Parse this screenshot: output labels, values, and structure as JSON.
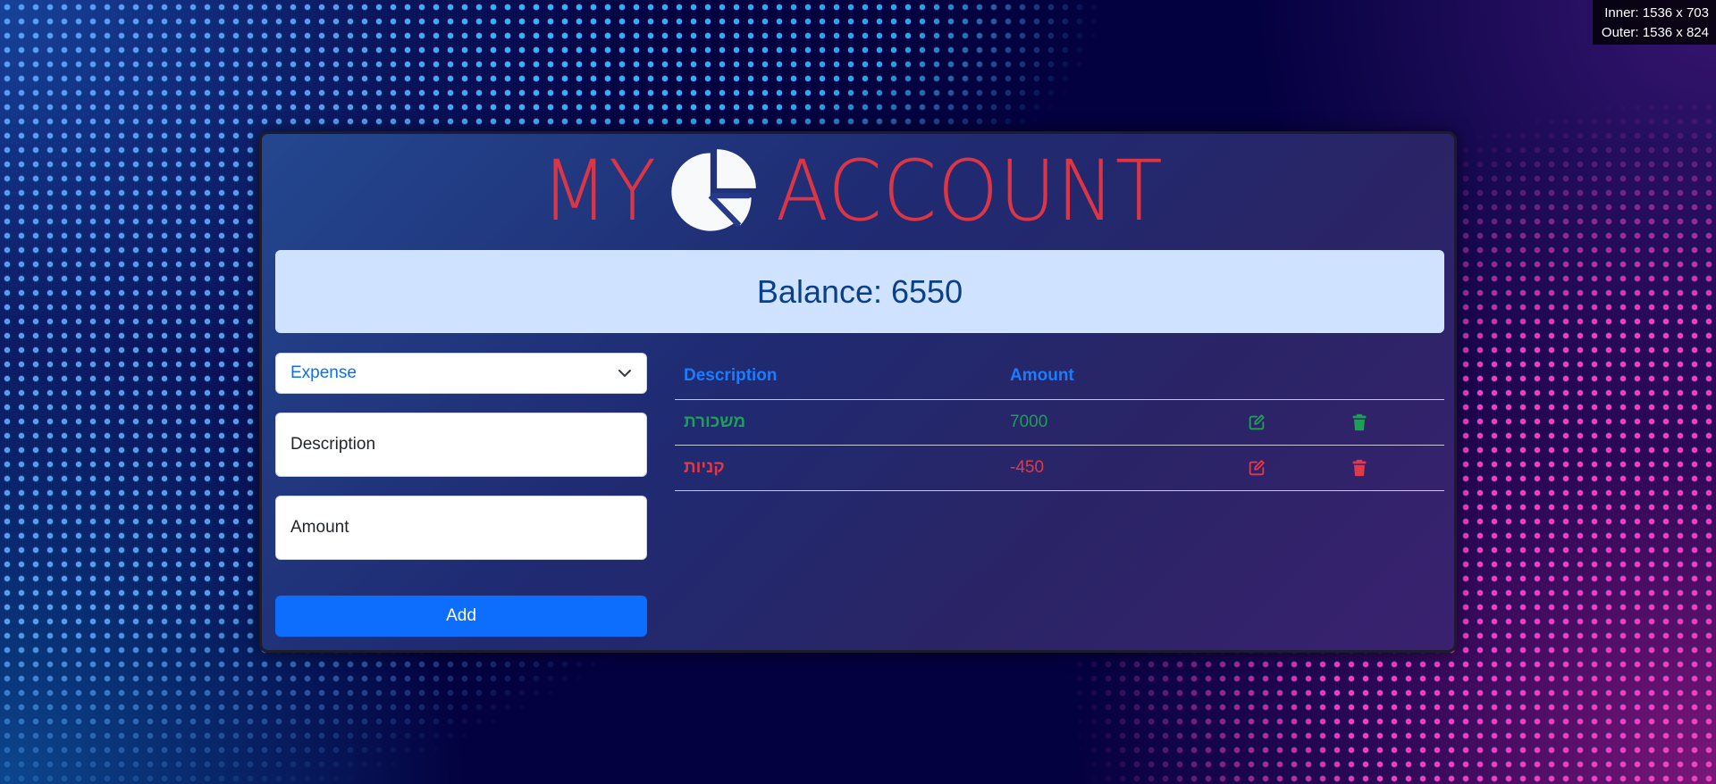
{
  "window_size_overlay": {
    "inner": "Inner: 1536 x 703",
    "outer": "Outer: 1536 x 824"
  },
  "logo": {
    "left_text": "MY",
    "right_text": "ACCOUNT",
    "icon": "pie-chart-icon",
    "color": "#dc3545"
  },
  "balance": {
    "text": "Balance: 6550"
  },
  "form": {
    "type_select": {
      "selected": "Expense"
    },
    "description_placeholder": "Description",
    "amount_placeholder": "Amount",
    "add_label": "Add"
  },
  "table": {
    "headers": {
      "description": "Description",
      "amount": "Amount"
    },
    "rows": [
      {
        "description": "משכורת",
        "amount": "7000",
        "kind": "income",
        "color": "#1f9e57"
      },
      {
        "description": "קניות",
        "amount": "-450",
        "kind": "expense",
        "color": "#e0394a"
      }
    ],
    "row_icons": {
      "edit": "edit-icon",
      "delete": "trash-icon"
    }
  },
  "colors": {
    "accent": "#0d6efd",
    "balance_bg": "#cfe2ff",
    "balance_text": "#0a3f8a"
  }
}
